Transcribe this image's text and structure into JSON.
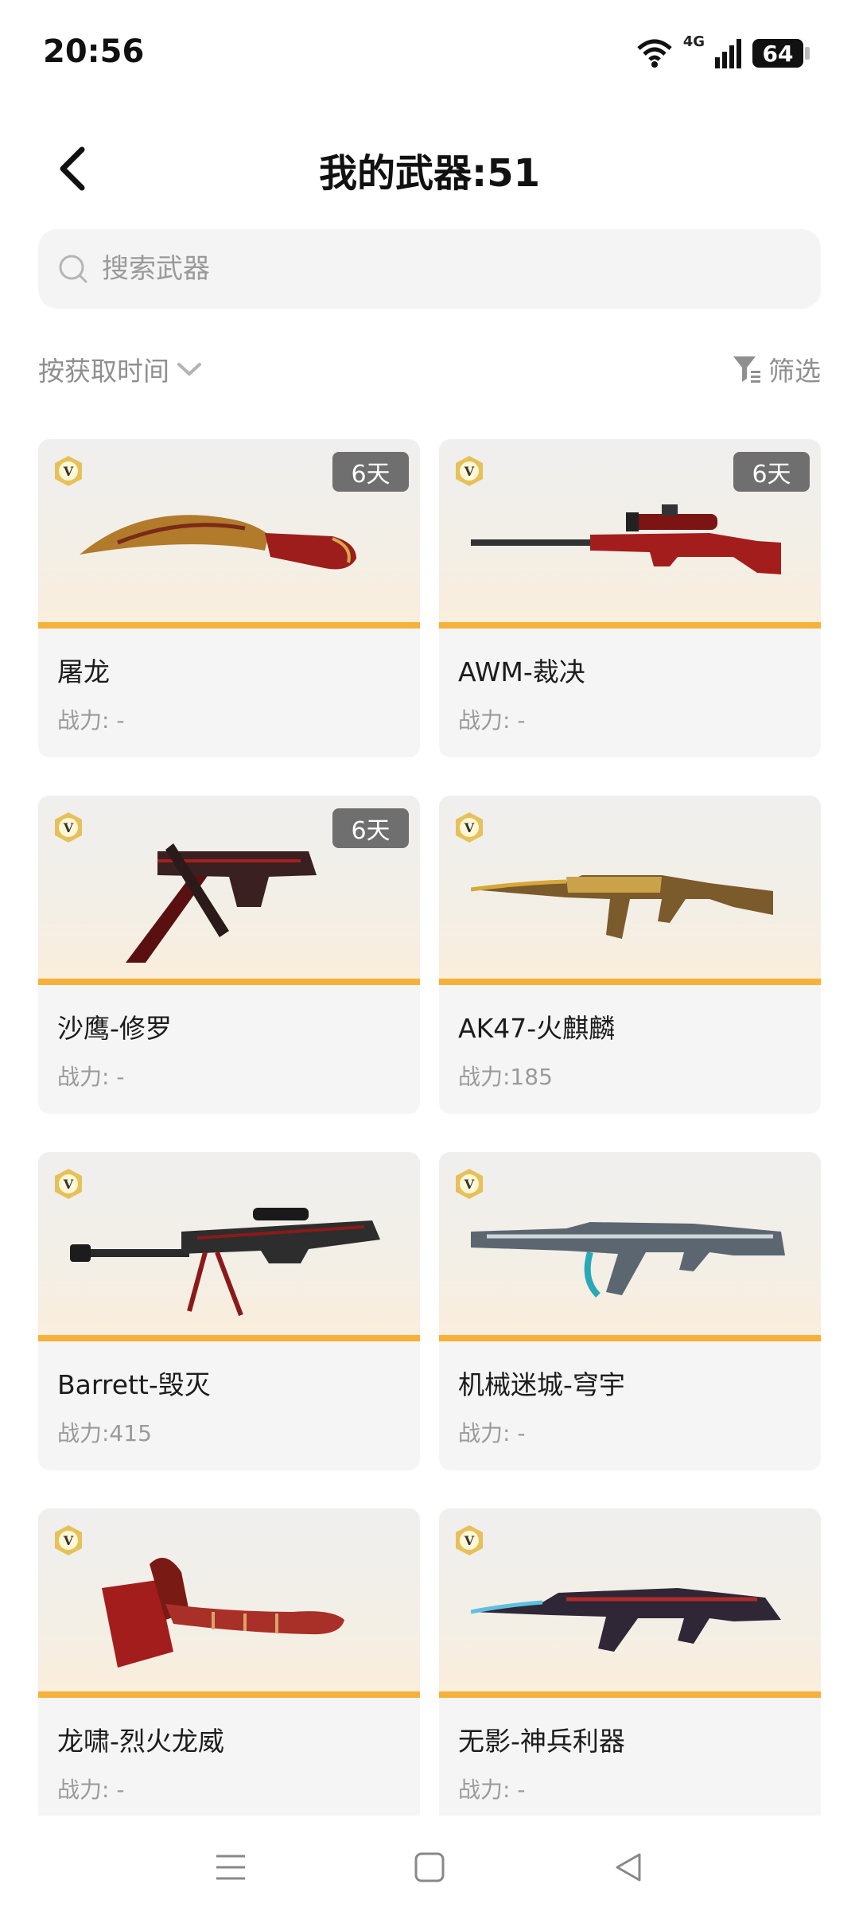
{
  "status": {
    "time": "20:56",
    "network": "4G",
    "battery": "64"
  },
  "header": {
    "title": "我的武器:51"
  },
  "search": {
    "placeholder": "搜索武器"
  },
  "sort": {
    "label": "按获取时间"
  },
  "filter": {
    "label": "筛选"
  },
  "weapons": [
    {
      "name": "屠龙",
      "power": "战力: -",
      "days": "6天",
      "art": "knife-art"
    },
    {
      "name": "AWM-裁决",
      "power": "战力: -",
      "days": "6天",
      "art": "sniper-art"
    },
    {
      "name": "沙鹰-修罗",
      "power": "战力: -",
      "days": "6天",
      "art": "pistol-art"
    },
    {
      "name": "AK47-火麒麟",
      "power": "战力:185",
      "days": "",
      "art": "rifle-art"
    },
    {
      "name": "Barrett-毁灭",
      "power": "战力:415",
      "days": "",
      "art": "barrett-art"
    },
    {
      "name": "机械迷城-穹宇",
      "power": "战力: -",
      "days": "",
      "art": "mech-rifle-art"
    },
    {
      "name": "龙啸-烈火龙威",
      "power": "战力: -",
      "days": "",
      "art": "axe-art"
    },
    {
      "name": "无影-神兵利器",
      "power": "战力: -",
      "days": "",
      "art": "shadow-rifle-art"
    }
  ],
  "colors": {
    "accent": "#f6b13a",
    "badge_bg": "#6f6f6f",
    "muted": "#9a9a9a"
  }
}
